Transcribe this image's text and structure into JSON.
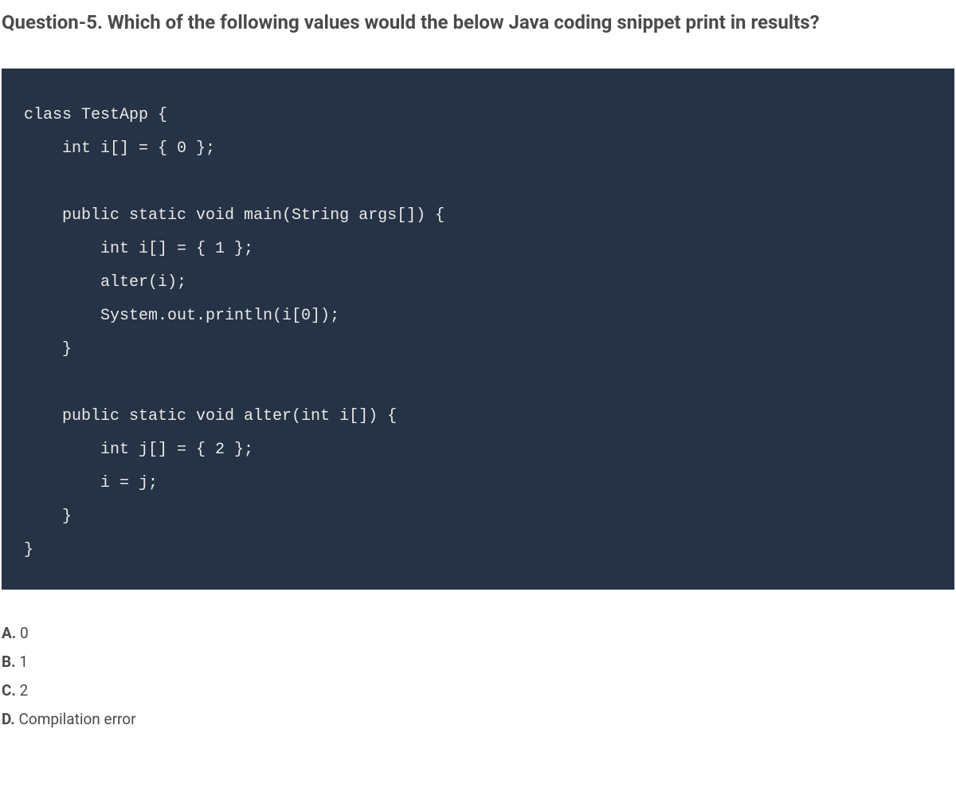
{
  "question": {
    "title": "Question-5. Which of the following values would the below Java coding snippet print in results?"
  },
  "code": {
    "lines": [
      "class TestApp {",
      "    int i[] = { 0 };",
      "",
      "    public static void main(String args[]) {",
      "        int i[] = { 1 };",
      "        alter(i);",
      "        System.out.println(i[0]);",
      "    }",
      "",
      "    public static void alter(int i[]) {",
      "        int j[] = { 2 };",
      "        i = j;",
      "    }",
      "}"
    ]
  },
  "options": [
    {
      "letter": "A.",
      "text": " 0"
    },
    {
      "letter": "B.",
      "text": " 1"
    },
    {
      "letter": "C.",
      "text": " 2"
    },
    {
      "letter": "D.",
      "text": " Compilation error"
    }
  ]
}
